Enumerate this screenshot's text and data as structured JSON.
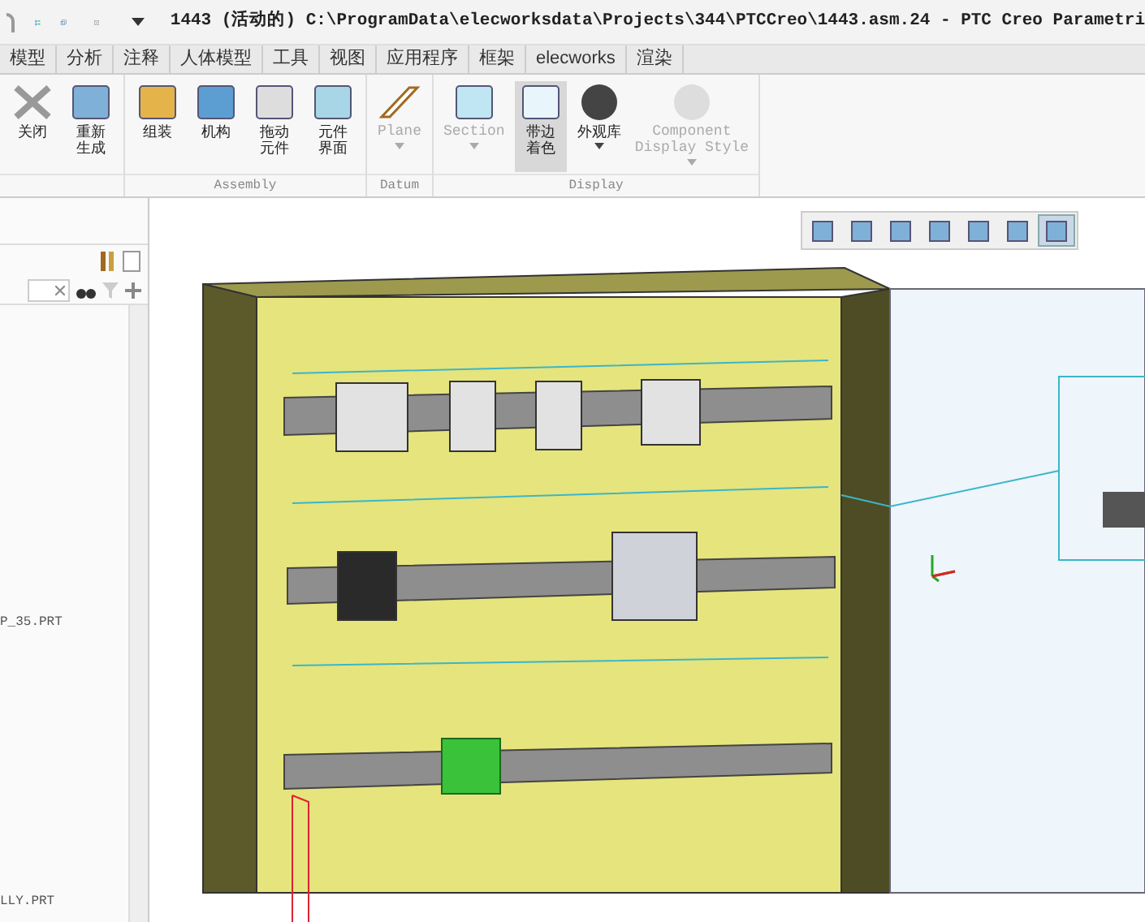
{
  "window": {
    "title": "1443 (活动的) C:\\ProgramData\\elecworksdata\\Projects\\344\\PTCCreo\\1443.asm.24 - PTC Creo Parametri"
  },
  "tabs": [
    {
      "label": "模型",
      "selected": false
    },
    {
      "label": "分析",
      "selected": false
    },
    {
      "label": "注释",
      "selected": false
    },
    {
      "label": "人体模型",
      "selected": false
    },
    {
      "label": "工具",
      "selected": false
    },
    {
      "label": "视图",
      "selected": false
    },
    {
      "label": "应用程序",
      "selected": false
    },
    {
      "label": "框架",
      "selected": false
    },
    {
      "label": "elecworks",
      "selected": false
    },
    {
      "label": "渲染",
      "selected": false
    }
  ],
  "ribbon": {
    "groups": [
      {
        "buttons": [
          {
            "label": "关闭",
            "kind": "single",
            "disabled": false,
            "selected": false,
            "dropdown": false
          },
          {
            "label": "重新生成",
            "kind": "stacked",
            "disabled": false,
            "selected": false,
            "dropdown": false
          }
        ]
      },
      {
        "label": "Assembly",
        "buttons": [
          {
            "label": "组装",
            "kind": "single",
            "disabled": false,
            "selected": false,
            "dropdown": false
          },
          {
            "label": "机构",
            "kind": "single",
            "disabled": false,
            "selected": false,
            "dropdown": false
          },
          {
            "label": "拖动元件",
            "kind": "stacked",
            "disabled": false,
            "selected": false,
            "dropdown": false
          },
          {
            "label": "元件界面",
            "kind": "stacked",
            "disabled": false,
            "selected": false,
            "dropdown": false
          }
        ]
      },
      {
        "label": "Datum",
        "buttons": [
          {
            "label": "Plane",
            "kind": "single",
            "disabled": true,
            "selected": false,
            "dropdown": true
          }
        ]
      },
      {
        "label": "Display",
        "buttons": [
          {
            "label": "Section",
            "kind": "single",
            "disabled": true,
            "selected": false,
            "dropdown": true
          },
          {
            "label": "带边着色",
            "kind": "stacked",
            "disabled": false,
            "selected": true,
            "dropdown": false
          },
          {
            "label": "外观库",
            "kind": "single",
            "disabled": false,
            "selected": false,
            "dropdown": true
          },
          {
            "label": "Component\nDisplay Style",
            "kind": "single",
            "disabled": true,
            "selected": false,
            "dropdown": true
          }
        ]
      }
    ]
  },
  "model_tree": {
    "items": [
      {
        "label": "P_35.PRT"
      },
      {
        "label": "LLY.PRT"
      }
    ]
  },
  "view_toolbar": [
    {
      "selected": false
    },
    {
      "selected": false
    },
    {
      "selected": false
    },
    {
      "selected": false
    },
    {
      "selected": false
    },
    {
      "selected": false
    },
    {
      "selected": true
    }
  ]
}
